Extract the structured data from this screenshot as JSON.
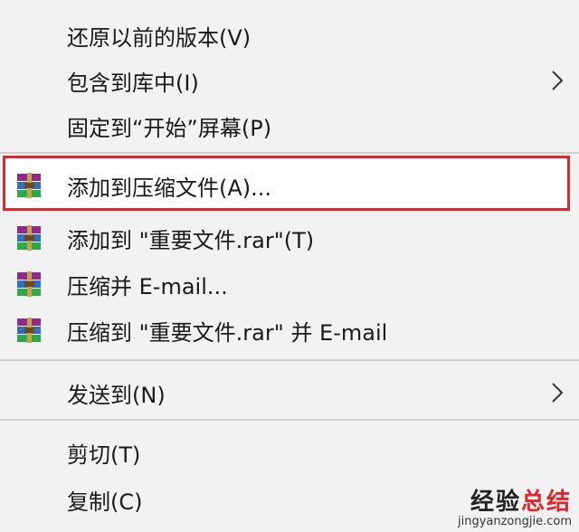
{
  "menu": {
    "items": [
      {
        "label": "还原以前的版本(V)",
        "icon": null,
        "submenu": false
      },
      {
        "label": "包含到库中(I)",
        "icon": null,
        "submenu": true
      },
      {
        "label": "固定到“开始”屏幕(P)",
        "icon": null,
        "submenu": false
      },
      {
        "label": "添加到压缩文件(A)...",
        "icon": "winrar-icon",
        "submenu": false,
        "highlighted": true
      },
      {
        "label": "添加到 \"重要文件.rar\"(T)",
        "icon": "winrar-icon",
        "submenu": false
      },
      {
        "label": "压缩并 E-mail...",
        "icon": "winrar-icon",
        "submenu": false
      },
      {
        "label": "压缩到 \"重要文件.rar\" 并 E-mail",
        "icon": "winrar-icon",
        "submenu": false
      },
      {
        "label": "发送到(N)",
        "icon": null,
        "submenu": true
      },
      {
        "label": "剪切(T)",
        "icon": null,
        "submenu": false
      },
      {
        "label": "复制(C)",
        "icon": null,
        "submenu": false
      }
    ]
  },
  "watermark": {
    "main_black": "经验",
    "main_red": "总结",
    "sub": "jingyanzongjie.com"
  },
  "colors": {
    "highlight_border": "#e0262e",
    "menu_background": "#f2f2f2",
    "separator": "#cfcfcf"
  }
}
